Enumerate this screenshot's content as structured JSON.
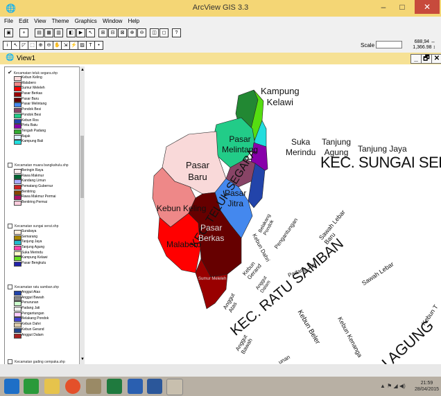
{
  "window": {
    "title": "ArcView GIS 3.3",
    "minimize": "–",
    "maximize": "□",
    "close": "✕"
  },
  "menu": [
    "File",
    "Edit",
    "View",
    "Theme",
    "Graphics",
    "Window",
    "Help"
  ],
  "toolbar": {
    "scale_label": "Scale 1:",
    "scale_value": "",
    "coord_x": "688,94 ↔",
    "coord_y": "1,366.98 ↕"
  },
  "view": {
    "title": "View1",
    "minimize": "_",
    "restore": "🗗",
    "close": "✕"
  },
  "toc": {
    "themes": [
      {
        "name": "Kecamatan teluk segara.shp",
        "checked": true,
        "items": [
          {
            "label": "Kebun Keling",
            "color": "#f9d9d9"
          },
          {
            "label": "Malabero",
            "color": "#ee8888"
          },
          {
            "label": "Sumur Meleleh",
            "color": "#ff0000"
          },
          {
            "label": "Pasar Berkas",
            "color": "#990000"
          },
          {
            "label": "Pasar Baru",
            "color": "#660000"
          },
          {
            "label": "Pasar Melintang",
            "color": "#4488ee"
          },
          {
            "label": "Pondok Besi",
            "color": "#884466"
          },
          {
            "label": "Pondok Besi",
            "color": "#22cc88"
          },
          {
            "label": "Kebun Ros",
            "color": "#2244aa"
          },
          {
            "label": "Pintu Batu",
            "color": "#8800aa"
          },
          {
            "label": "Tengah Padang",
            "color": "#33aa33"
          },
          {
            "label": "Bajak",
            "color": "#ddeeff"
          },
          {
            "label": "Kampung Bali",
            "color": "#22dddd"
          }
        ]
      },
      {
        "name": "Kecamatan muara bangkahulu.shp",
        "checked": false,
        "items": [
          {
            "label": "Beringin Raya",
            "color": "#ffeeee"
          },
          {
            "label": "Rawa Makmur",
            "color": "#006633"
          },
          {
            "label": "Kandang Limun",
            "color": "#aaaaff"
          },
          {
            "label": "Pematang Gubernur",
            "color": "#cc2222"
          },
          {
            "label": "Bentiring",
            "color": "#884400"
          },
          {
            "label": "Rawa Makmur Permai",
            "color": "#aa1166"
          },
          {
            "label": "Bentiring Permai",
            "color": "#ffccdd"
          }
        ]
      },
      {
        "name": "Kecamatan sungai serut.shp",
        "checked": false,
        "items": [
          {
            "label": "Surabaya",
            "color": "#ffeedd"
          },
          {
            "label": "Semarang",
            "color": "#aa8800"
          },
          {
            "label": "Tanjung Jaya",
            "color": "#22bbcc"
          },
          {
            "label": "Tanjung Agung",
            "color": "#ff44aa"
          },
          {
            "label": "Suka Merindu",
            "color": "#ffffcc"
          },
          {
            "label": "Kampung Kelawi",
            "color": "#66dd22"
          },
          {
            "label": "Pasar Bengkulu",
            "color": "#2222aa"
          }
        ]
      },
      {
        "name": "Kecamatan ratu samban.shp",
        "checked": false,
        "items": [
          {
            "label": "Anggut Atas",
            "color": "#2244aa"
          },
          {
            "label": "Anggut Bawah",
            "color": "#888888"
          },
          {
            "label": "Penurunan",
            "color": "#ccffcc"
          },
          {
            "label": "Padang Jati",
            "color": "#eeeeee"
          },
          {
            "label": "Pengantungan",
            "color": "#ffccff"
          },
          {
            "label": "Belakang Pondok",
            "color": "#4444cc"
          },
          {
            "label": "Kebun Dahri",
            "color": "#ddccaa"
          },
          {
            "label": "Kebun Gerand",
            "color": "#224488"
          },
          {
            "label": "Anggut Dalam",
            "color": "#aa2222"
          }
        ]
      }
    ],
    "trailing": "Kecamatan gading cempaka.shp"
  },
  "map": {
    "labels": {
      "kampung_kelawi": [
        "Kampung",
        "Kelawi"
      ],
      "suka_merindu": [
        "Suka",
        "Merindu"
      ],
      "tanjung_agung": [
        "Tanjung",
        "Agung"
      ],
      "tanjung_jaya": "Tanjung Jaya",
      "kec_sungai_serut": "KEC. SUNGAI SERUT",
      "pasar_melintang": [
        "Pasar",
        "Melintang"
      ],
      "pasar_baru": [
        "Pasar",
        "Baru"
      ],
      "kec_teluk_segara": "KEC. TELUK SEGARA",
      "kebun_keling": "Kebun Keling",
      "pasar_jitra": [
        "Pasar",
        "Jitra"
      ],
      "pasar_berkas": [
        "Pasar",
        "Berkas"
      ],
      "malabero": "Malabero",
      "sumur_meleleh": "Sumur Meleleh",
      "kec_ratu_samban": "KEC. RATU SAMBAN",
      "belakang_pondok": [
        "Belakang",
        "Pondok"
      ],
      "pengantungan": "Pengantungan",
      "sawah_lebar_baru": [
        "Sawah Lebar",
        "Baru"
      ],
      "kebun_dahri": "Kebun Dahri",
      "kebun_gerand": [
        "Kebun",
        "Gerand"
      ],
      "padang_jati": "Padang Jati",
      "anggut_dalam": [
        "Anggut",
        "Dalam"
      ],
      "sawah_lebar": "Sawah Lebar",
      "anggut_atas": [
        "Anggut",
        "Atas"
      ],
      "anggut_bawah": [
        "Anggut",
        "Bawah"
      ],
      "kebun_beler": "Kebun Beler",
      "kebun_kenanga": "Kebun Kenanga",
      "tu_agung": "TU AGUNG",
      "kebun_right": "Kebun T",
      "penurunan": "unan"
    }
  },
  "taskbar": {
    "time": "21:59",
    "date": "28/04/2015",
    "tray": "▲ ⚑ ◢ ◀)"
  }
}
